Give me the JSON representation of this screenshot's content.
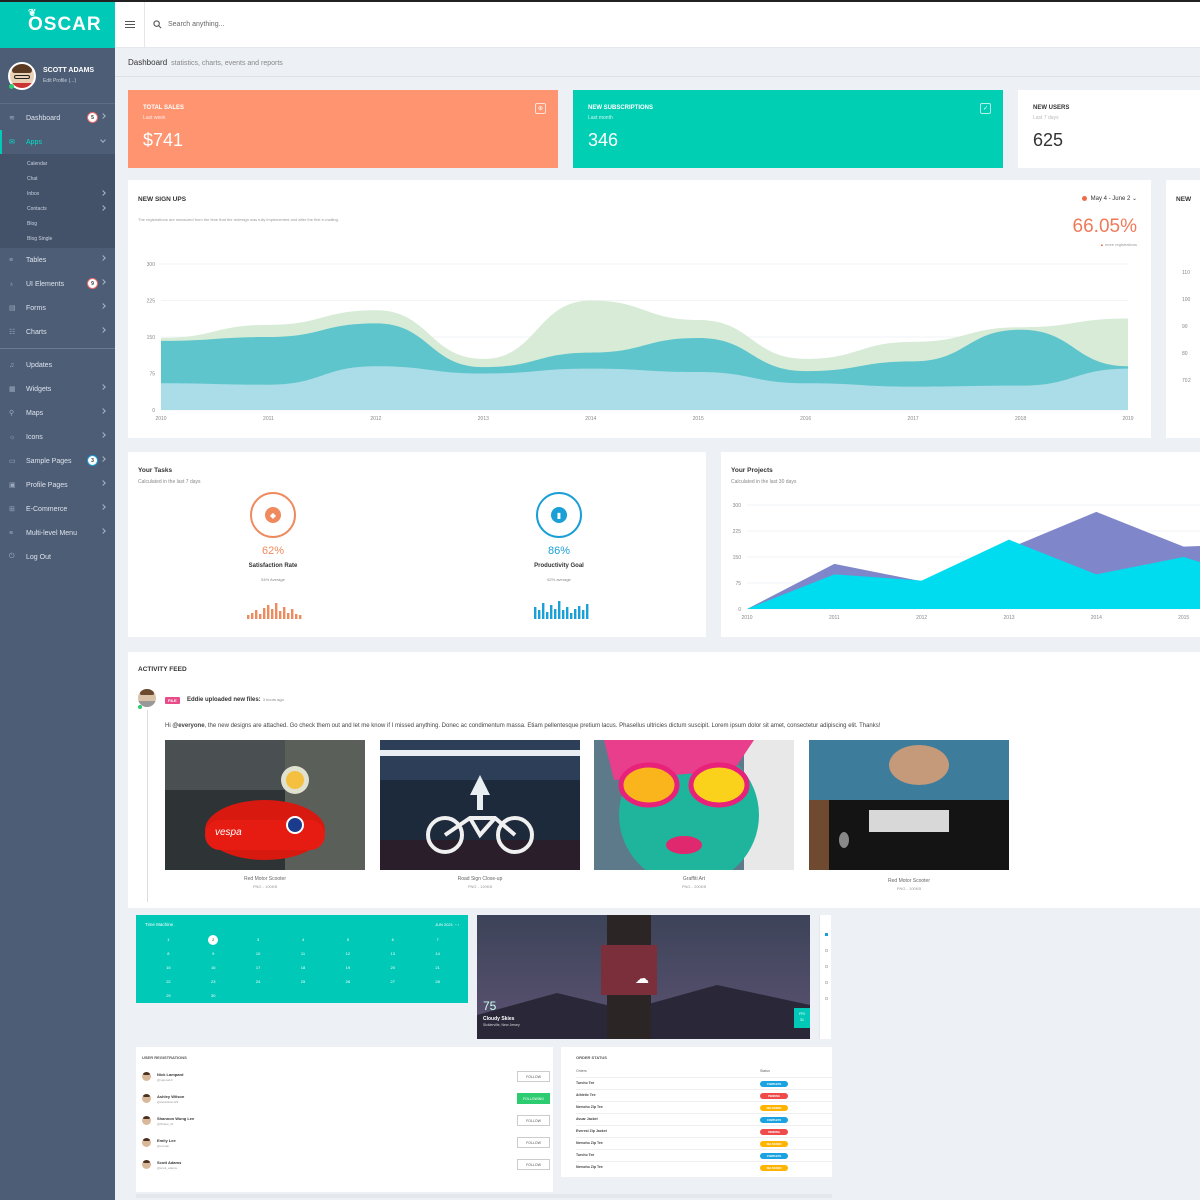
{
  "app": {
    "brand": "OSCAR"
  },
  "search": {
    "placeholder": "Search anything..."
  },
  "user": {
    "name": "SCOTT ADAMS",
    "edit": "Edit Profile (...)"
  },
  "nav": {
    "dashboard": {
      "label": "Dashboard",
      "badge": "5"
    },
    "apps": {
      "label": "Apps",
      "sub": [
        "Calendar",
        "Chat",
        "Inbox",
        "Contacts",
        "Blog",
        "Blog Single"
      ]
    },
    "tables": "Tables",
    "ui": {
      "label": "UI Elements",
      "badge": "9"
    },
    "forms": "Forms",
    "charts": "Charts",
    "updates": "Updates",
    "widgets": "Widgets",
    "maps": "Maps",
    "icons": "Icons",
    "sample": {
      "label": "Sample Pages",
      "badge": "3"
    },
    "profile": "Profile Pages",
    "ecommerce": "E-Commerce",
    "multilevel": "Multi-level Menu",
    "logout": "Log Out"
  },
  "breadcrumb": {
    "title": "Dashboard",
    "subtitle": "statistics, charts, events and reports"
  },
  "stats": [
    {
      "title": "TOTAL SALES",
      "sub": "Last week",
      "value": "$741",
      "color": "#ff9470"
    },
    {
      "title": "NEW SUBSCRIPTIONS",
      "sub": "Last month",
      "value": "346",
      "color": "#00cfb4"
    },
    {
      "title": "NEW USERS",
      "sub": "Last 7 days",
      "value": "625",
      "color": "#ffffff"
    }
  ],
  "signups": {
    "title": "NEW SIGN UPS",
    "desc": "The registrations are measured from the time that the redesign was fully implemented and after the first e-mailing.",
    "range": "May 4 - June 2",
    "percent": "66.05%",
    "percent_sub": "more registrations"
  },
  "side_card": {
    "title": "NEW",
    "ticks": [
      "110",
      "100",
      "90",
      "80",
      "70",
      "2"
    ]
  },
  "chart_data": [
    {
      "type": "area",
      "x": [
        2010,
        2011,
        2012,
        2013,
        2014,
        2015,
        2016,
        2017,
        2018,
        2019
      ],
      "ylim": [
        0,
        300
      ],
      "yticks": [
        0,
        75,
        150,
        225,
        300
      ],
      "series": [
        {
          "values": [
            148,
            175,
            205,
            105,
            225,
            185,
            105,
            140,
            170,
            188
          ],
          "color": "#d7ebd6"
        },
        {
          "values": [
            142,
            150,
            178,
            88,
            118,
            148,
            80,
            100,
            165,
            90
          ],
          "color": "#5ec5cc"
        },
        {
          "values": [
            55,
            52,
            90,
            75,
            85,
            78,
            55,
            48,
            50,
            85
          ],
          "color": "#aadde8"
        }
      ]
    },
    {
      "type": "area",
      "x": [
        2010,
        2011,
        2012,
        2013,
        2014,
        2015,
        2016
      ],
      "ylim": [
        0,
        300
      ],
      "yticks": [
        0,
        75,
        150,
        225,
        300
      ],
      "series": [
        {
          "values": [
            0,
            130,
            80,
            175,
            280,
            180,
            190
          ],
          "color": "#7f86c9"
        },
        {
          "values": [
            0,
            100,
            82,
            200,
            100,
            150,
            70
          ],
          "color": "#00dcef"
        }
      ]
    }
  ],
  "tasks": {
    "title": "Your Tasks",
    "sub": "Calculated in the last 7 days",
    "g1": {
      "value": "62%",
      "label": "Satisfaction Rate",
      "sub": "54% Average",
      "color": "#ef8a5e",
      "bars": [
        4,
        6,
        9,
        5,
        11,
        14,
        10,
        16,
        8,
        12,
        6,
        10,
        5,
        4
      ]
    },
    "g2": {
      "value": "86%",
      "label": "Productivity Goal",
      "sub": "62% average",
      "color": "#1a9fd6",
      "bars": [
        12,
        9,
        16,
        7,
        14,
        10,
        18,
        9,
        12,
        6,
        10,
        13,
        9,
        15
      ]
    }
  },
  "projects": {
    "title": "Your Projects",
    "sub": "Calculated in the last 30 days"
  },
  "feed": {
    "title": "ACTIVITY FEED",
    "tag": "FILE",
    "line": "Eddie uploaded new files:",
    "time": "3 hours ago",
    "mention": "@everyone",
    "text_pre": "Hi ",
    "text_post": ", the new designs are attached. Go check them out and let me know if I missed anything. Donec ac condimentum massa. Etiam pellentesque pretium lacus. Phasellus ultricies dictum suscipit. Lorem ipsum dolor sit amet, consectetur adipiscing elit. Thanks!",
    "files": [
      {
        "name": "Red Motor Scooter",
        "meta": "PNG - 100KB"
      },
      {
        "name": "Road Sign Close-up",
        "meta": "PNG - 120KB"
      },
      {
        "name": "Graffiti Art",
        "meta": "PNG - 200KB"
      },
      {
        "name": "Red Motor Scooter",
        "meta": "PNG - 100KB"
      }
    ]
  },
  "calendar": {
    "title": "Time Machine",
    "month": "JUN 2021",
    "days": [
      "1",
      "2",
      "3",
      "4",
      "5",
      "6",
      "7",
      "8",
      "9",
      "10",
      "11",
      "12",
      "13",
      "14",
      "15",
      "16",
      "17",
      "18",
      "19",
      "20",
      "21",
      "22",
      "23",
      "24",
      "25",
      "26",
      "27",
      "28",
      "29",
      "30"
    ],
    "selected": "2"
  },
  "weather": {
    "temp": "75",
    "label": "Cloudy Skies",
    "location": "Sicklerville, New Jersey",
    "day": "FRI",
    "date": "31"
  },
  "registrations": {
    "title": "USER REGISTRATIONS",
    "rows": [
      {
        "name": "Nick Lampard",
        "handle": "@nigona19",
        "button": "FOLLOW",
        "following": false
      },
      {
        "name": "Ashley Wilson",
        "handle": "@ashwilson123",
        "button": "FOLLOWING",
        "following": true
      },
      {
        "name": "Shannon Wong Lee",
        "handle": "@Shane_W",
        "button": "FOLLOW",
        "following": false
      },
      {
        "name": "Emily Lee",
        "handle": "@emstar",
        "button": "FOLLOW",
        "following": false
      },
      {
        "name": "Scott Adams",
        "handle": "@scott_adams",
        "button": "FOLLOW",
        "following": false
      }
    ]
  },
  "orders": {
    "title": "ORDER STATUS",
    "col_orders": "Orders",
    "col_status": "Status",
    "rows": [
      {
        "order": "Turcho Tee",
        "status": "COMPLETE",
        "color": "#1aa3e0"
      },
      {
        "order": "Athletic Tee",
        "status": "PENDING",
        "color": "#ef4b4b"
      },
      {
        "order": "Nemcho Zip Tee",
        "status": "DELIVERED",
        "color": "#ffb400"
      },
      {
        "order": "Avuar Jacket",
        "status": "COMPLETE",
        "color": "#1aa3e0"
      },
      {
        "order": "Everest Zip Jacket",
        "status": "PENDING",
        "color": "#ef4b4b"
      },
      {
        "order": "Nemcho Zip Tee",
        "status": "DELIVERED",
        "color": "#ffb400"
      },
      {
        "order": "Turcho Tee",
        "status": "COMPLETE",
        "color": "#1aa3e0"
      },
      {
        "order": "Nemcho Zip Tee",
        "status": "DELIVERED",
        "color": "#ffb400"
      }
    ]
  }
}
